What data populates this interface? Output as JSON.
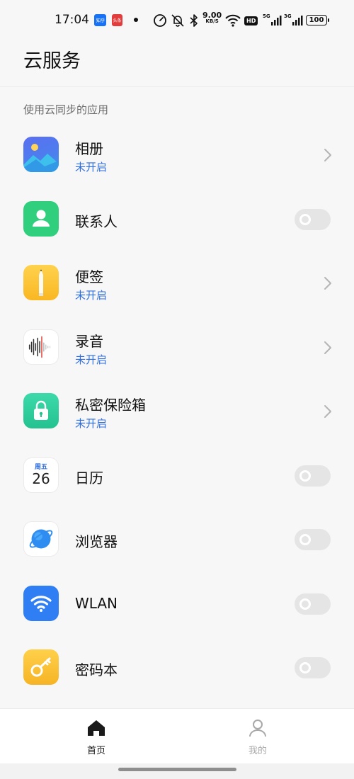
{
  "status_bar": {
    "time": "17:04",
    "badge_1": "知乎",
    "badge_2": "头条",
    "speed_value": "9.00",
    "speed_unit": "KB/S",
    "hd_label": "HD",
    "net_1": "5G",
    "net_2": "3G",
    "battery": "100",
    "colors": {
      "badge_1": "#1772f6",
      "badge_2": "#e23c3c"
    }
  },
  "header": {
    "title": "云服务"
  },
  "section": {
    "label": "使用云同步的应用"
  },
  "apps": [
    {
      "name": "相册",
      "status": "未开启",
      "control": "chevron",
      "icon": "gallery-icon"
    },
    {
      "name": "联系人",
      "status": "",
      "control": "toggle",
      "icon": "contacts-icon"
    },
    {
      "name": "便签",
      "status": "未开启",
      "control": "chevron",
      "icon": "notes-icon"
    },
    {
      "name": "录音",
      "status": "未开启",
      "control": "chevron",
      "icon": "recorder-icon"
    },
    {
      "name": "私密保险箱",
      "status": "未开启",
      "control": "chevron",
      "icon": "private-safe-icon"
    },
    {
      "name": "日历",
      "status": "",
      "control": "toggle",
      "icon": "calendar-icon",
      "icon_text": {
        "weekday": "周五",
        "day": "26"
      }
    },
    {
      "name": "浏览器",
      "status": "",
      "control": "toggle",
      "icon": "browser-icon"
    },
    {
      "name": "WLAN",
      "status": "",
      "control": "toggle",
      "icon": "wifi-icon"
    },
    {
      "name": "密码本",
      "status": "",
      "control": "toggle",
      "icon": "key-icon"
    }
  ],
  "toggles_on": [
    false,
    false,
    false,
    false,
    false
  ],
  "bottom_nav": {
    "home": "首页",
    "mine": "我的",
    "active": "home"
  },
  "colors": {
    "status_text": "#2f6ee0",
    "toggle_off": "#e5e5e5"
  }
}
